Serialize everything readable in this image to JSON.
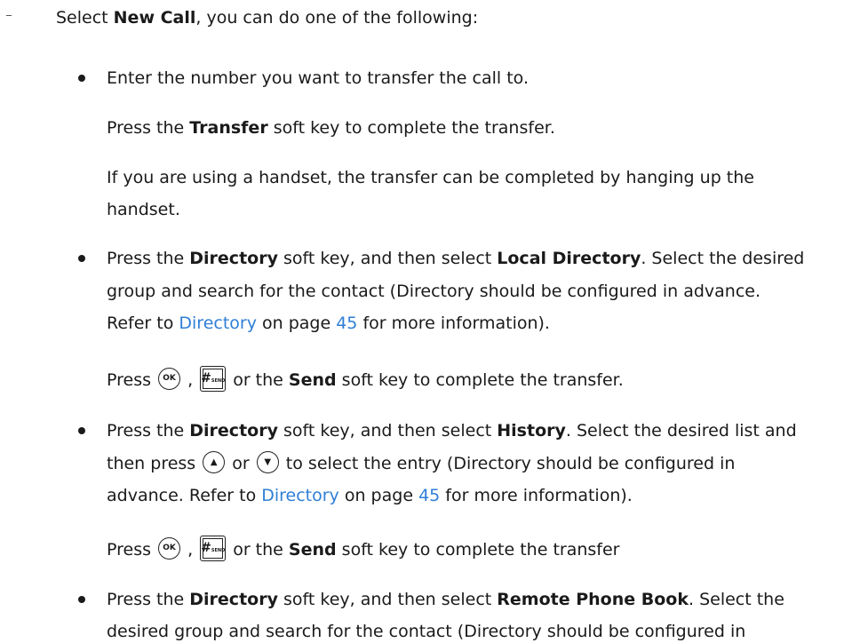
{
  "intro": {
    "prefix": "Select ",
    "bold": "New Call",
    "suffix": ", you can do one of the following:"
  },
  "items": [
    {
      "line1": "Enter the number you want to transfer the call to.",
      "press_a": "Press the ",
      "press_bold": "Transfer",
      "press_b": " soft key to complete the transfer.",
      "handset_1": "If you are using a handset, the transfer can be completed by hanging up the",
      "handset_2": "handset."
    },
    {
      "l1_a": "Press the ",
      "l1_b1": "Directory",
      "l1_c": " soft key, and then select ",
      "l1_b2": "Local Directory",
      "l1_d": ". Select the desired",
      "l2": "group and search for the contact (Directory should be configured in advance.",
      "l3_a": "Refer to ",
      "l3_link": "Directory",
      "l3_b": " on page ",
      "l3_page": "45",
      "l3_c": " for more information).",
      "press_a": "Press ",
      "key_ok": "OK",
      "comma": " , ",
      "key_hash": "#",
      "key_hash_sub": "SEND",
      "press_b": " or the ",
      "press_bold": "Send",
      "press_c": " soft key to complete the transfer."
    },
    {
      "l1_a": "Press the ",
      "l1_b1": "Directory",
      "l1_c": " soft key, and then select ",
      "l1_b2": "History",
      "l1_d": ". Select the desired list and",
      "l2_a": "then press ",
      "key_up": "▲",
      "l2_or": " or ",
      "key_down": "▼",
      "l2_b": " to select the entry (Directory should be configured in",
      "l3_a": "advance. Refer to ",
      "l3_link": "Directory",
      "l3_b": " on page ",
      "l3_page": "45",
      "l3_c": " for more information).",
      "press_a": "Press ",
      "key_ok": "OK",
      "comma": " , ",
      "key_hash": "#",
      "key_hash_sub": "SEND",
      "press_b": " or the ",
      "press_bold": "Send",
      "press_c": " soft key to complete the transfer"
    },
    {
      "l1_a": "Press the ",
      "l1_b1": "Directory",
      "l1_c": " soft key, and then select ",
      "l1_b2": "Remote Phone Book",
      "l1_d": ". Select the",
      "l2": "desired group and search for the contact (Directory should be configured in"
    }
  ],
  "colors": {
    "text": "#1a1a1a",
    "link": "#2f7fd6"
  }
}
